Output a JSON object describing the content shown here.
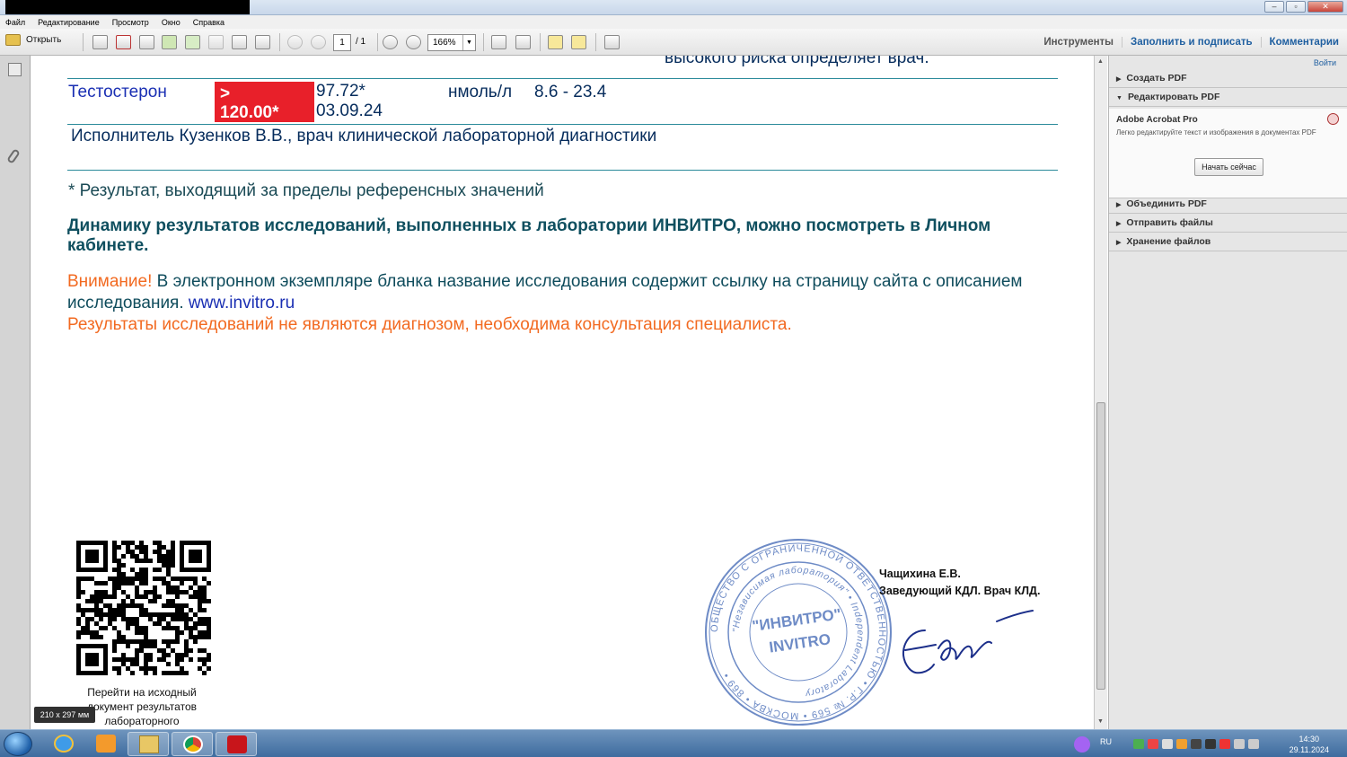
{
  "window": {
    "title_redacted": true
  },
  "menubar": {
    "items": [
      "Файл",
      "Редактирование",
      "Просмотр",
      "Окно",
      "Справка"
    ]
  },
  "toolbar": {
    "open_label": "Открыть",
    "page_current": "1",
    "page_total": "/ 1",
    "zoom": "166%"
  },
  "top_links": {
    "tools": "Инструменты",
    "fill_sign": "Заполнить и подписать",
    "comments": "Комментарии"
  },
  "document": {
    "risk_text": "высокого риска определяет врач.",
    "row": {
      "name": "Тестостерон",
      "result_line1": ">",
      "result_line2": "120.00*",
      "prev_value": "97.72*",
      "prev_date": "03.09.24",
      "unit": "нмоль/л",
      "reference": "8.6 - 23.4"
    },
    "performer": "Исполнитель Кузенков В.В., врач клинической лабораторной диагностики",
    "footnote": "* Результат, выходящий за пределы референсных значений",
    "dynamics": "Динамику результатов исследований, выполненных в лаборатории ИНВИТРО, можно посмотреть в Личном кабинете.",
    "attention_label": "Внимание!",
    "attention_text": " В электронном экземпляре бланка название исследования содержит ссылку на страницу сайта с описанием исследования. ",
    "site_link": "www.invitro.ru",
    "disclaimer": "Результаты исследований не являются диагнозом, необходима консультация специалиста.",
    "qr_caption": "Перейти на исходный документ результатов лабораторного тестирования",
    "signer_name": "Чащихина Е.В.",
    "signer_title": "Заведующий КДЛ. Врач КЛД.",
    "page_size": "210 x 297 мм",
    "stamp": {
      "outer_text": "ОБЩЕСТВО С ОГРАНИЧЕННОЙ ОТВЕТСТВЕННОСТЬЮ • Г.Р. № 569 • МОСКВА • 869 •",
      "inner_text": "\"Независимая лаборатория\" • Independent Laboratory",
      "center1": "\"ИНВИТРО\"",
      "center2": "INVITRO"
    }
  },
  "right_panel": {
    "sign_in": "Войти",
    "sections": [
      "Создать PDF",
      "Редактировать PDF",
      "Объединить PDF",
      "Отправить файлы",
      "Хранение файлов"
    ],
    "edit_title": "Adobe Acrobat Pro",
    "edit_desc": "Легко редактируйте текст и изображения в документах PDF",
    "edit_button": "Начать сейчас"
  },
  "taskbar": {
    "lang": "RU",
    "time": "14:30",
    "date": "29.11.2024"
  },
  "colors": {
    "accent_red": "#e8202a",
    "teal": "#2b8a9a",
    "orange": "#f26a21",
    "link_blue": "#1a2fb3"
  }
}
